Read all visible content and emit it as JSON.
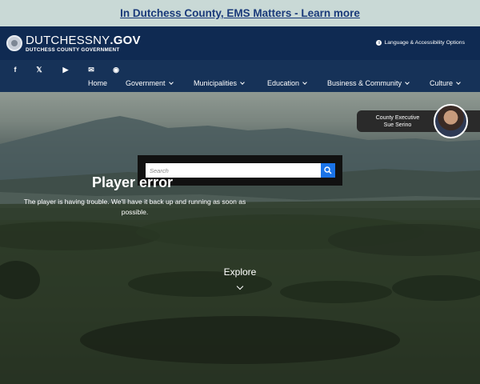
{
  "alert": {
    "text": "In Dutchess County, EMS Matters - Learn more"
  },
  "header": {
    "logo_main_prefix": "DUTCHESSNY",
    "logo_main_suffix": ".GOV",
    "logo_sub": "DUTCHESS COUNTY GOVERNMENT",
    "language_label": "Language & Accessibility Options"
  },
  "social": [
    {
      "name": "facebook-icon",
      "glyph": "f"
    },
    {
      "name": "x-icon",
      "glyph": "𝕏"
    },
    {
      "name": "youtube-icon",
      "glyph": "▶"
    },
    {
      "name": "email-icon",
      "glyph": "✉"
    },
    {
      "name": "rss-icon",
      "glyph": "◉"
    }
  ],
  "nav": [
    {
      "label": "Home",
      "has_caret": false
    },
    {
      "label": "Government",
      "has_caret": true
    },
    {
      "label": "Municipalities",
      "has_caret": true
    },
    {
      "label": "Education",
      "has_caret": true
    },
    {
      "label": "Business & Community",
      "has_caret": true
    },
    {
      "label": "Culture",
      "has_caret": true
    }
  ],
  "executive": {
    "title": "County Executive",
    "name": "Sue Serino"
  },
  "search": {
    "placeholder": "Search"
  },
  "player": {
    "title": "Player error",
    "message": "The player is having trouble. We'll have it back up and running as soon as possible."
  },
  "explore": {
    "label": "Explore"
  },
  "colors": {
    "header_bg": "#0f2a52",
    "nav_bg": "#163258",
    "alert_bg": "#c9d9d6",
    "search_button": "#1a73e8"
  }
}
